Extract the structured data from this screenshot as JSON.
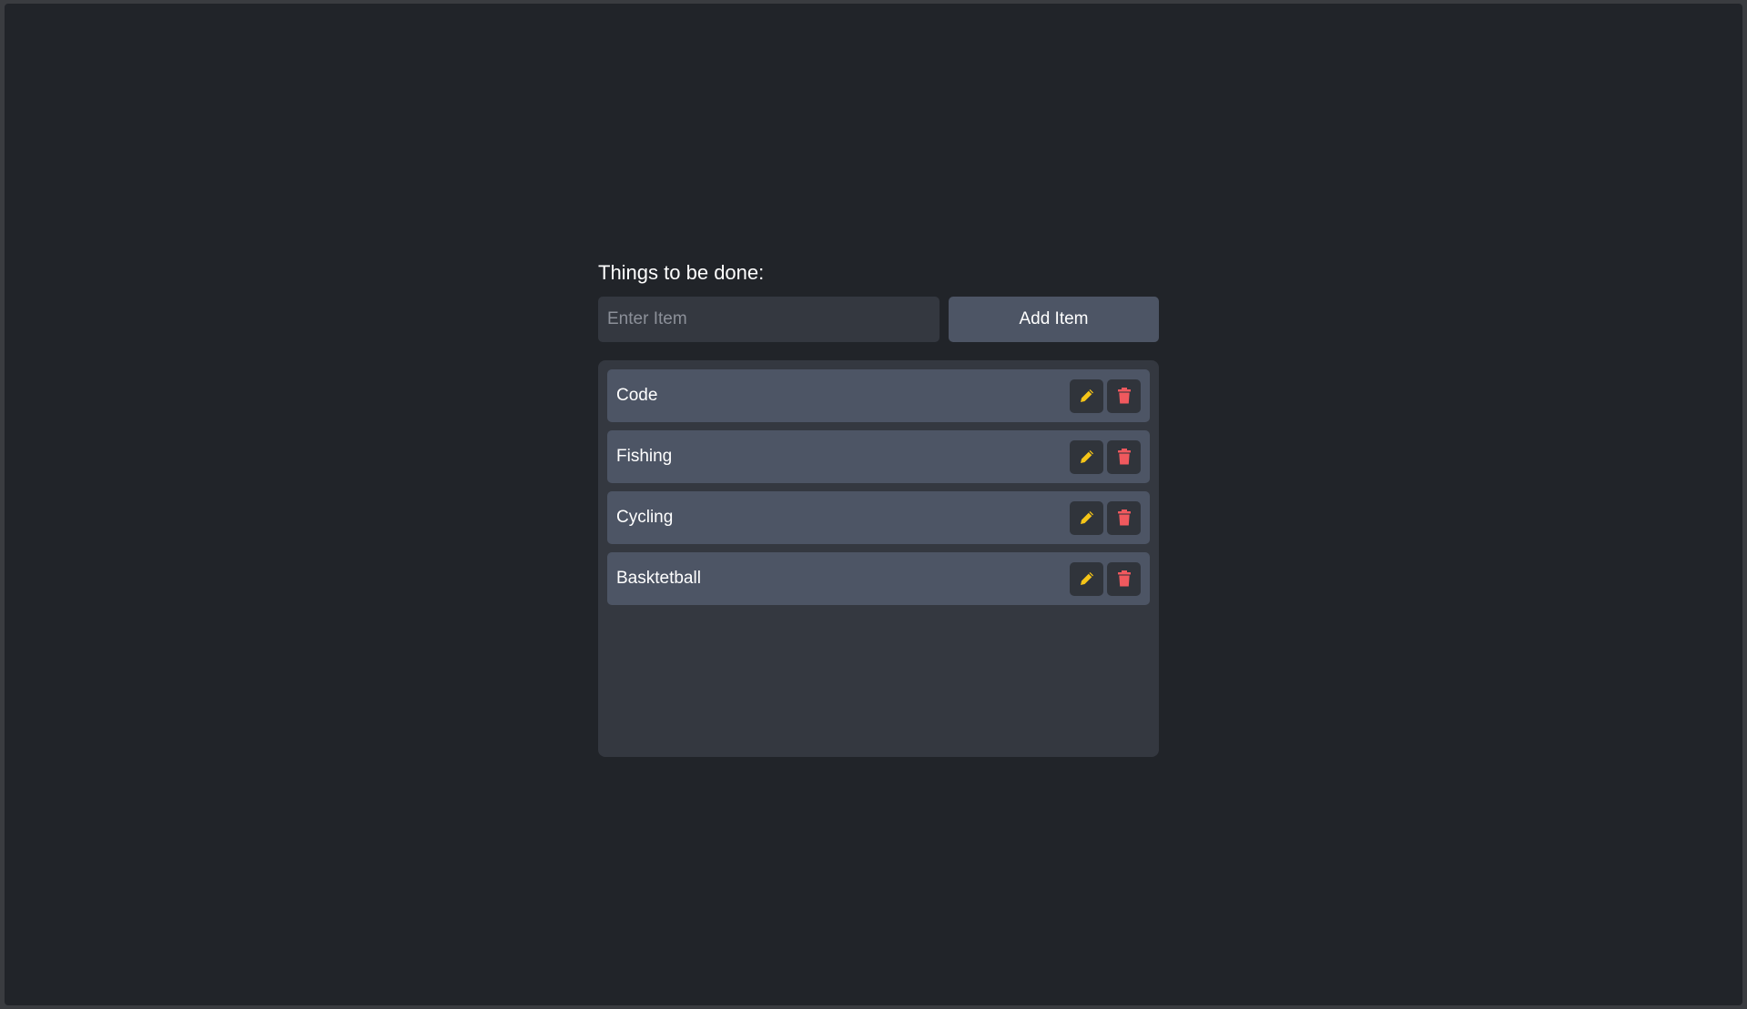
{
  "todo": {
    "heading": "Things to be done:",
    "input_placeholder": "Enter Item",
    "input_value": "",
    "add_button_label": "Add Item",
    "items": [
      {
        "label": "Code"
      },
      {
        "label": "Fishing"
      },
      {
        "label": "Cycling"
      },
      {
        "label": "Basktetball"
      }
    ]
  },
  "icons": {
    "edit": "pencil-icon",
    "delete": "trash-icon"
  },
  "colors": {
    "background": "#212429",
    "panel": "#343840",
    "item": "#4d5565",
    "icon_button": "#30343b",
    "edit_icon": "#f5c518",
    "delete_icon": "#f0595e",
    "text": "#ffffff"
  }
}
